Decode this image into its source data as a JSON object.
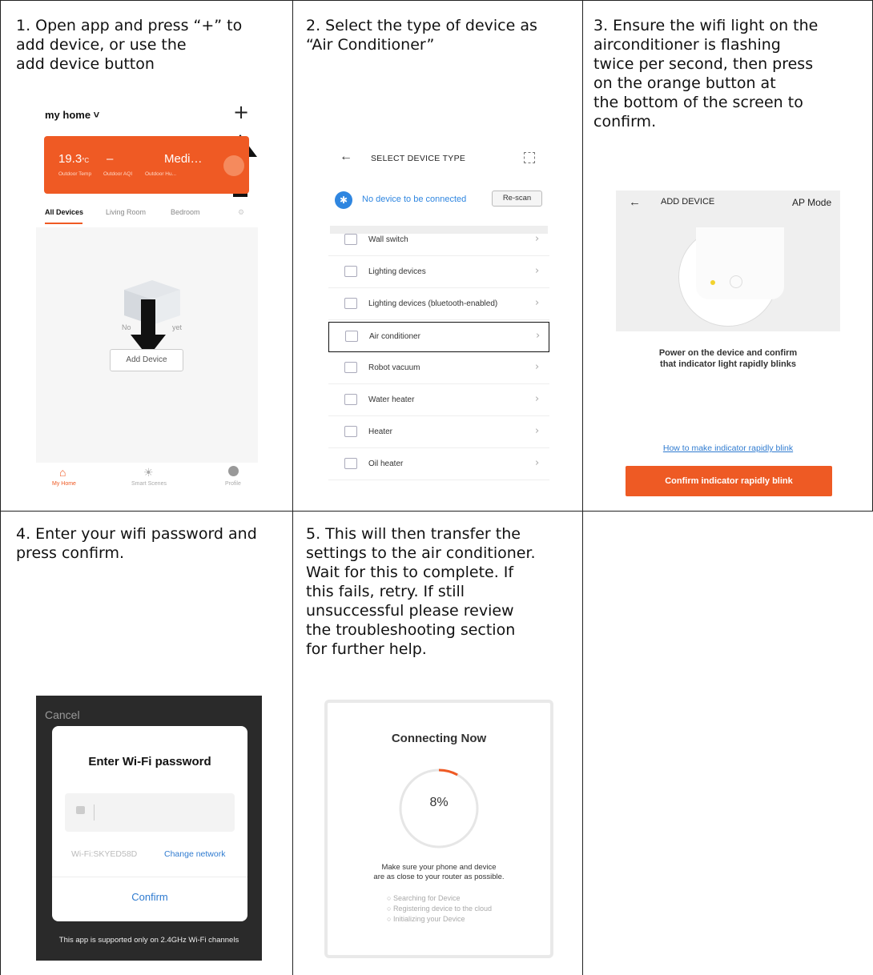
{
  "steps": [
    {
      "text": "1. Open app and press “+” to\n   add device, or use the\n   add device button"
    },
    {
      "text": "2. Select the type of device as\n   “Air Conditioner”"
    },
    {
      "text": "3. Ensure the wifi light on the\n   airconditioner is flashing\n   twice per second, then press\n   on the orange button at\n   the bottom of the screen to\n   confirm."
    },
    {
      "text": "4. Enter your wifi password and\n   press confirm."
    },
    {
      "text": "5. This will then transfer the\n   settings to the air conditioner.\n   Wait for this to complete. If\n   this fails, retry. If still\n   unsuccessful please review\n   the troubleshooting section\n   for further help."
    }
  ],
  "shot1": {
    "home_label": "my home ˅",
    "plus": "+",
    "card": {
      "temp": "19.3",
      "temp_unit": "°C",
      "aqi": "–",
      "humidity": "Medi…",
      "temp_label": "Outdoor Temp",
      "aqi_label": "Outdoor AQI",
      "humidity_label": "Outdoor Hu..."
    },
    "tabs": [
      "All Devices",
      "Living Room",
      "Bedroom"
    ],
    "empty_text_left": "No",
    "empty_text_right": "yet",
    "add_device": "Add Device",
    "nav": [
      "My Home",
      "Smart Scenes",
      "Profile"
    ]
  },
  "shot2": {
    "title": "SELECT DEVICE TYPE",
    "bt_text": "No device to be connected",
    "rescan": "Re-scan",
    "items": [
      "Wall switch",
      "Lighting devices",
      "Lighting devices (bluetooth-enabled)",
      "Air conditioner",
      "Robot vacuum",
      "Water heater",
      "Heater",
      "Oil heater"
    ],
    "highlighted": "Air conditioner"
  },
  "shot3": {
    "title": "ADD DEVICE",
    "mode": "AP Mode",
    "message_line1": "Power on the device and confirm",
    "message_line2": "that indicator light rapidly blinks",
    "link": "How to make indicator rapidly blink",
    "button": "Confirm indicator rapidly blink"
  },
  "shot4": {
    "cancel": "Cancel",
    "title": "Enter Wi-Fi password",
    "wifi": "Wi-Fi:SKYED58D",
    "change": "Change network",
    "confirm": "Confirm",
    "note": "This app is supported only on 2.4GHz Wi-Fi channels"
  },
  "shot5": {
    "title": "Connecting Now",
    "percent": "8%",
    "progress_fraction": 0.08,
    "msg_line1": "Make sure your phone and device",
    "msg_line2": "are as close to your router as possible.",
    "steps": [
      "Searching for Device",
      "Registering device to the cloud",
      "Initializing your Device"
    ]
  },
  "colors": {
    "accent": "#ef5a24",
    "link": "#2f7bd0",
    "bluetooth": "#2f86e0"
  }
}
